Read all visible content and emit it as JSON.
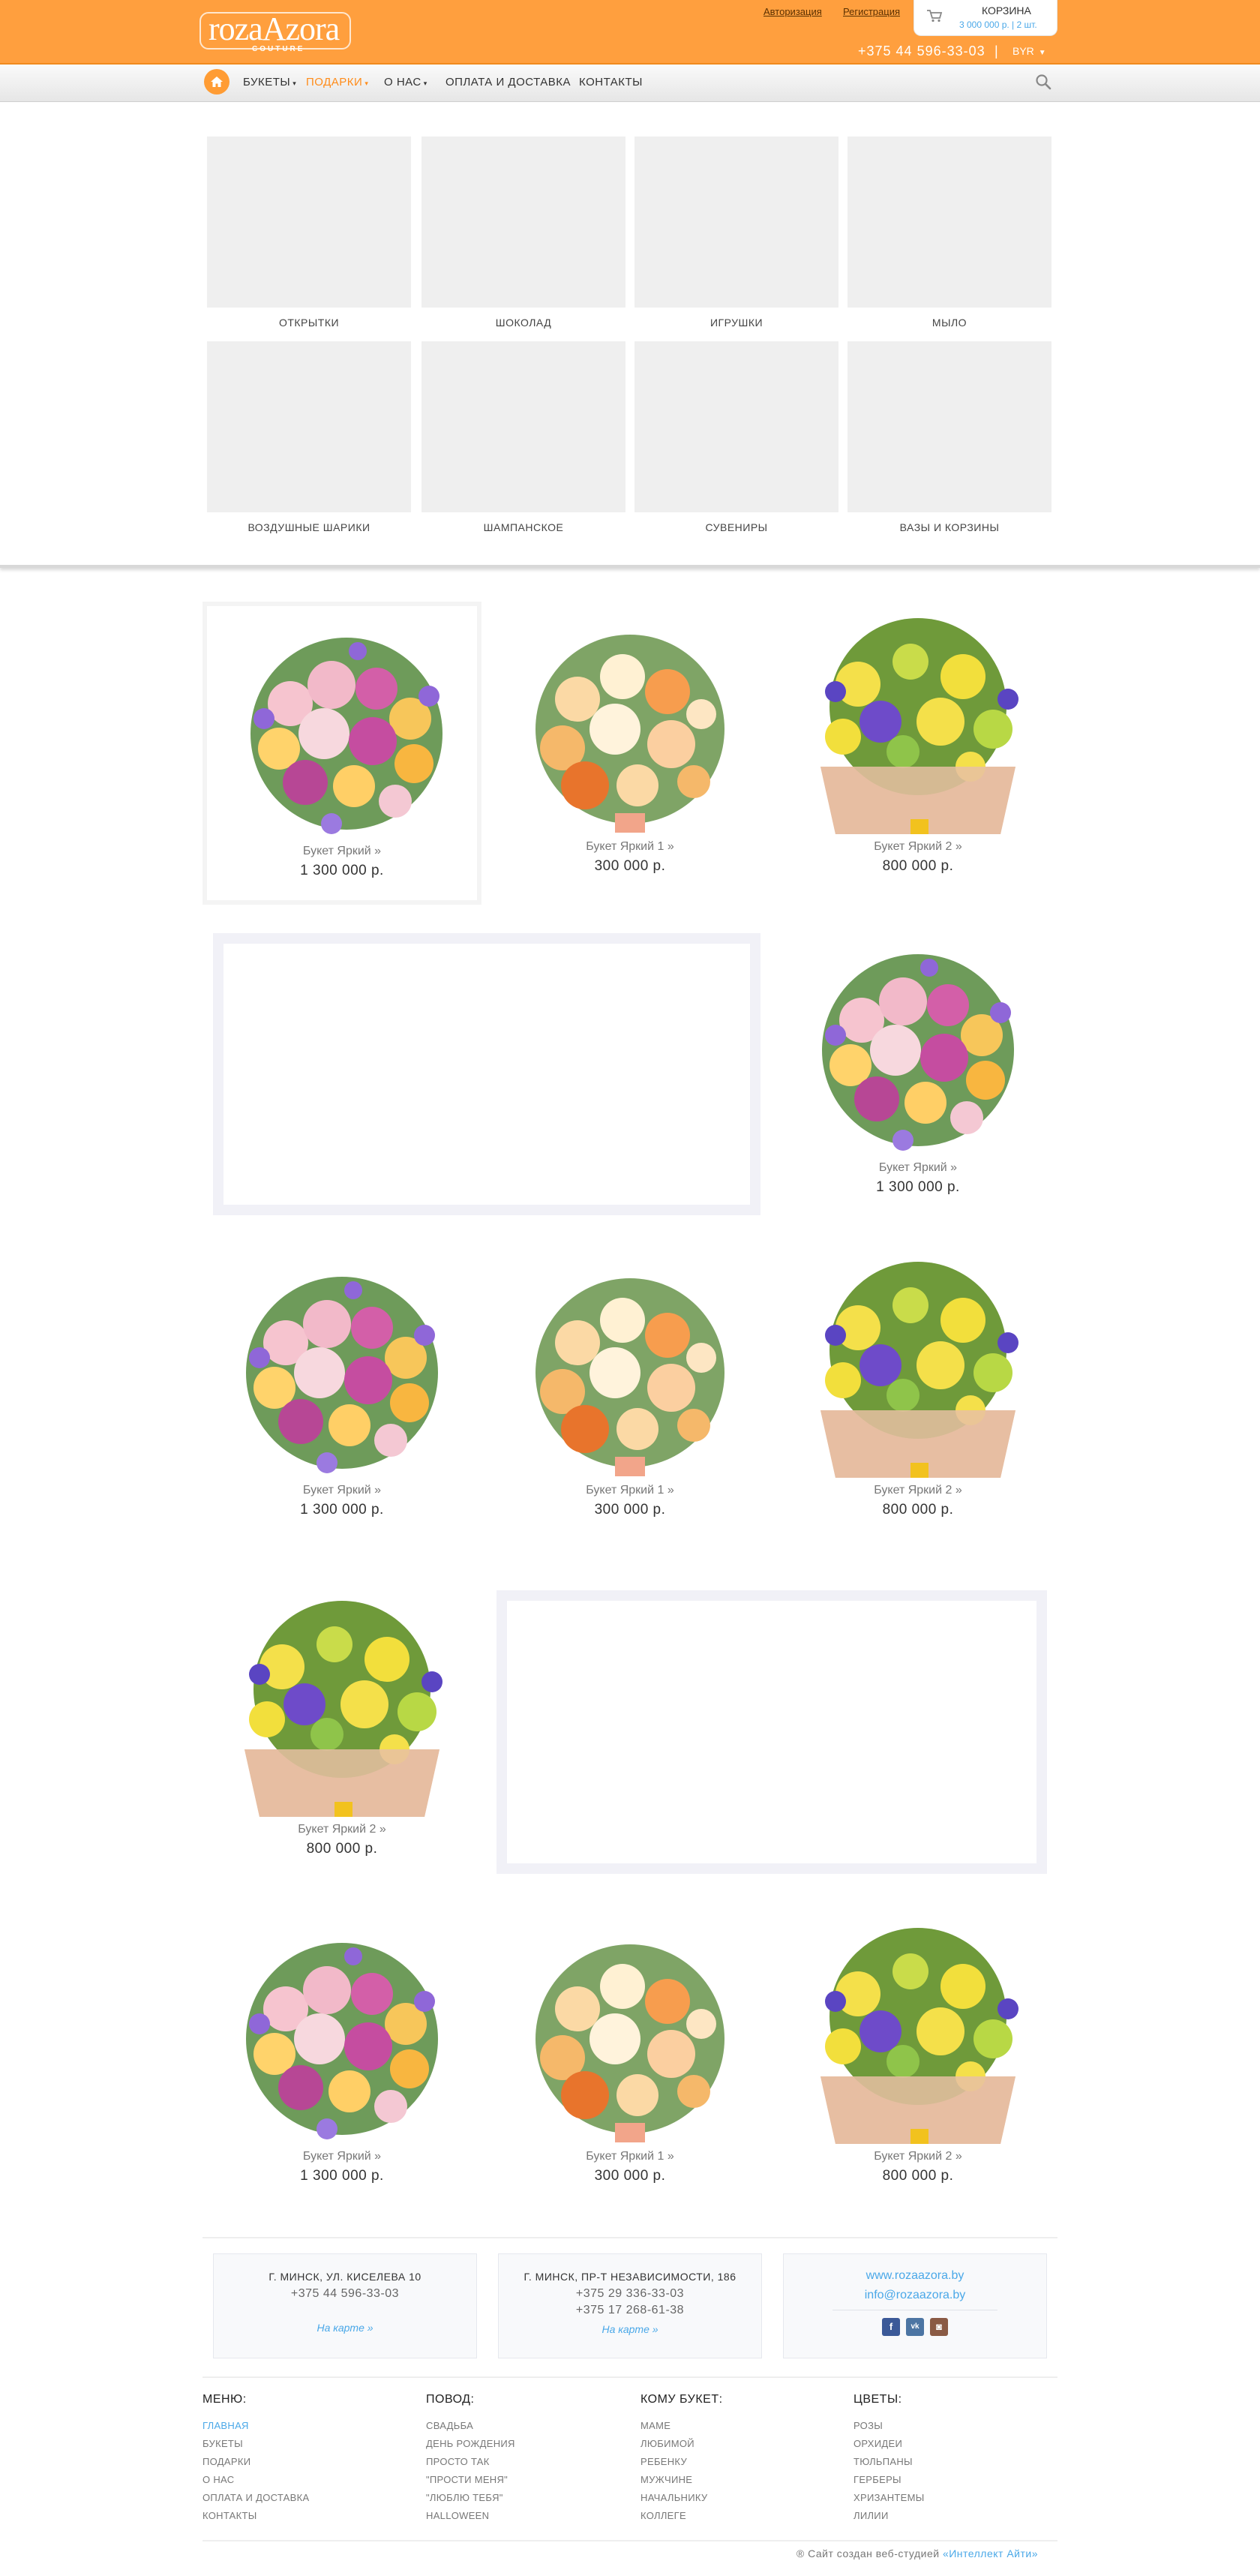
{
  "header": {
    "logo_text": "rozaAzora",
    "logo_sub": "COUTURE",
    "auth_login": "Авторизация",
    "auth_register": "Регистрация",
    "cart_title": "КОРЗИНА",
    "cart_summary": "3 000 000 р. | 2 шт.",
    "phone": "+375 44 596-33-03",
    "separator": "|",
    "currency": "BYR",
    "accent_color": "#ff9f3e",
    "link_color": "#4aa8e8"
  },
  "nav": {
    "items": [
      {
        "label": "БУКЕТЫ",
        "caret": "▾"
      },
      {
        "label": "ПОДАРКИ",
        "caret": "▾"
      },
      {
        "label": "О НАС",
        "caret": "▾"
      },
      {
        "label": "ОПЛАТА И ДОСТАВКА",
        "caret": ""
      },
      {
        "label": "КОНТАКТЫ",
        "caret": ""
      }
    ]
  },
  "gift_categories": [
    {
      "label": "ОТКРЫТКИ"
    },
    {
      "label": "ШОКОЛАД"
    },
    {
      "label": "ИГРУШКИ"
    },
    {
      "label": "МЫЛО"
    },
    {
      "label": "ВОЗДУШНЫЕ ШАРИКИ"
    },
    {
      "label": "ШАМПАНСКОЕ"
    },
    {
      "label": "СУВЕНИРЫ"
    },
    {
      "label": "ВАЗЫ И КОРЗИНЫ"
    }
  ],
  "products": [
    {
      "name": "Букет Яркий  »",
      "price": "1 300 000 р."
    },
    {
      "name": "Букет Яркий 1 »",
      "price": "300 000 р."
    },
    {
      "name": "Букет Яркий 2 »",
      "price": "800 000 р."
    },
    {
      "name": "Букет Яркий  »",
      "price": "1 300 000 р."
    },
    {
      "name": "Букет Яркий  »",
      "price": "1 300 000 р."
    },
    {
      "name": "Букет Яркий 1 »",
      "price": "300 000 р."
    },
    {
      "name": "Букет Яркий 2 »",
      "price": "800 000 р."
    },
    {
      "name": "Букет Яркий 2 »",
      "price": "800 000 р."
    },
    {
      "name": "Букет Яркий  »",
      "price": "1 300 000 р."
    },
    {
      "name": "Букет Яркий 1 »",
      "price": "300 000 р."
    },
    {
      "name": "Букет Яркий 2 »",
      "price": "800 000 р."
    }
  ],
  "contacts": [
    {
      "address": "Г. МИНСК, УЛ. КИСЕЛЕВА 10",
      "phones": [
        "+375 44 596-33-03"
      ],
      "map": "На карте »"
    },
    {
      "address": "Г. МИНСК, ПР-Т НЕЗАВИСИМОСТИ, 186",
      "phones": [
        "+375 29 336-33-03",
        "+375 17 268-61-38"
      ],
      "map": "На карте »"
    }
  ],
  "web": {
    "site": "www.rozaazora.by",
    "email": "info@rozaazora.by",
    "socials": [
      "f",
      "vk",
      "ig"
    ]
  },
  "footer": {
    "menu": {
      "title": "МЕНЮ:",
      "items": [
        "ГЛАВНАЯ",
        "БУКЕТЫ",
        "ПОДАРКИ",
        "О НАС",
        "ОПЛАТА И ДОСТАВКА",
        "КОНТАКТЫ"
      ]
    },
    "occasion": {
      "title": "ПОВОД:",
      "items": [
        "СВАДЬБА",
        "ДЕНЬ РОЖДЕНИЯ",
        "ПРОСТО ТАК",
        "\"ПРОСТИ МЕНЯ\"",
        "\"ЛЮБЛЮ ТЕБЯ\"",
        "HALLOWEEN"
      ]
    },
    "recipient": {
      "title": "КОМУ БУКЕТ:",
      "items": [
        "МАМЕ",
        "ЛЮБИМОЙ",
        "РЕБЕНКУ",
        "МУЖЧИНЕ",
        "НАЧАЛЬНИКУ",
        "КОЛЛЕГЕ"
      ]
    },
    "flowers": {
      "title": "ЦВЕТЫ:",
      "items": [
        "РОЗЫ",
        "ОРХИДЕИ",
        "ТЮЛЬПАНЫ",
        "ГЕРБЕРЫ",
        "ХРИЗАНТЕМЫ",
        "ЛИЛИИ"
      ]
    },
    "copyright_prefix": "® Сайт создан веб-студией ",
    "copyright_link": "«Интеллект Айти»"
  }
}
